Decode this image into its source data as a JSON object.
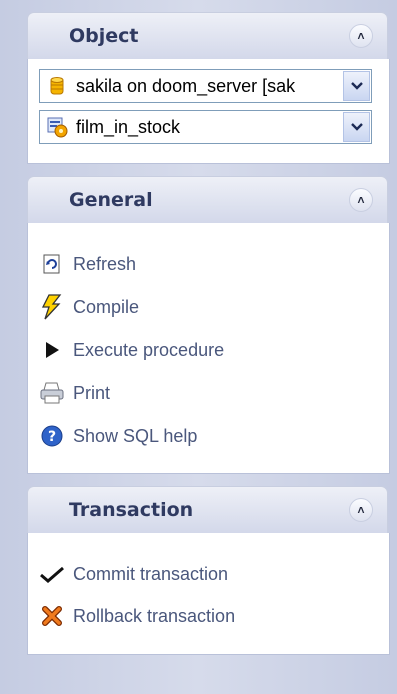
{
  "object_panel": {
    "title": "Object",
    "database_select": {
      "value": "sakila on doom_server [sak"
    },
    "object_select": {
      "value": "film_in_stock"
    }
  },
  "general_panel": {
    "title": "General",
    "items": [
      {
        "label": "Refresh",
        "icon": "refresh-icon"
      },
      {
        "label": "Compile",
        "icon": "lightning-icon"
      },
      {
        "label": "Execute procedure",
        "icon": "play-icon"
      },
      {
        "label": "Print",
        "icon": "printer-icon"
      },
      {
        "label": "Show SQL help",
        "icon": "help-icon"
      }
    ]
  },
  "transaction_panel": {
    "title": "Transaction",
    "items": [
      {
        "label": "Commit transaction",
        "icon": "check-icon"
      },
      {
        "label": "Rollback transaction",
        "icon": "x-icon"
      }
    ]
  }
}
